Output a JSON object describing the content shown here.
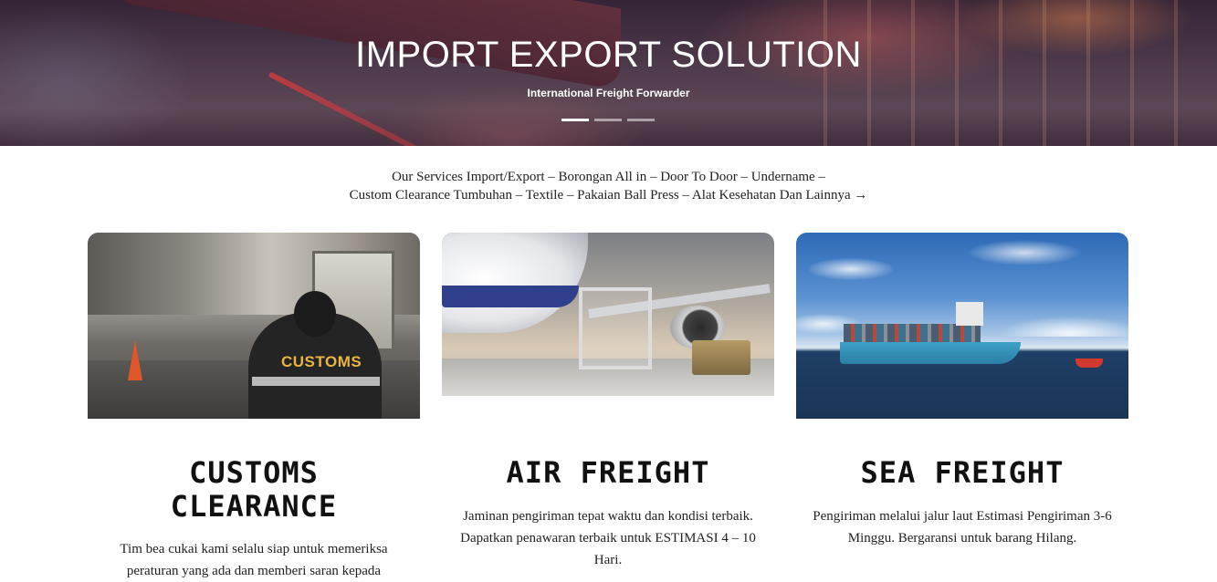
{
  "hero": {
    "title": "IMPORT EXPORT SOLUTION",
    "subtitle": "International Freight Forwarder",
    "slides": 3,
    "active_slide": 1
  },
  "services": {
    "line1": "Our Services Import/Export – Borongan All in – Door To Door – Undername –",
    "line2": "Custom Clearance Tumbuhan – Textile – Pakaian Ball Press – Alat Kesehatan Dan Lainnya →"
  },
  "cards": [
    {
      "title_line1": "CUSTOMS",
      "title_line2": "CLEARANCE",
      "desc": "Tim bea cukai kami selalu siap untuk memeriksa peraturan yang ada dan memberi saran kepada",
      "image_text": "CUSTOMS"
    },
    {
      "title_line1": "AIR FREIGHT",
      "title_line2": "",
      "desc": "Jaminan pengiriman tepat waktu dan kondisi terbaik. Dapatkan penawaran terbaik untuk ESTIMASI 4 – 10 Hari."
    },
    {
      "title_line1": "SEA FREIGHT",
      "title_line2": "",
      "desc": "Pengiriman melalui jalur laut Estimasi Pengiriman 3-6 Minggu. Bergaransi untuk barang Hilang."
    }
  ]
}
